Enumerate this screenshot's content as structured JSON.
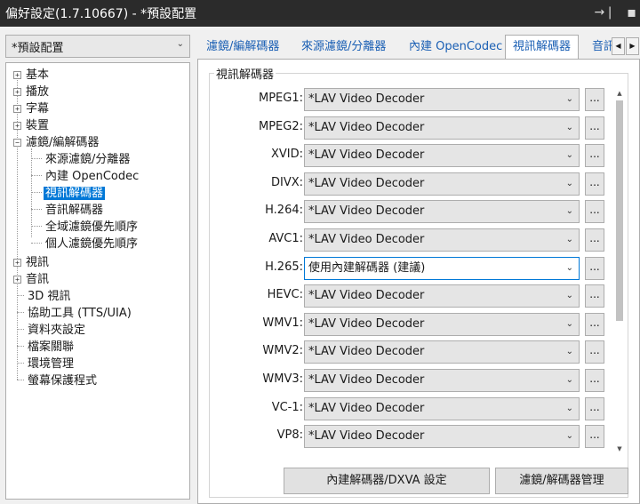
{
  "window": {
    "title": "偏好設定(1.7.10667) - *預設配置"
  },
  "preset": {
    "value": "*預設配置"
  },
  "tree": {
    "items": [
      {
        "label": "基本",
        "expander": "+"
      },
      {
        "label": "播放",
        "expander": "+"
      },
      {
        "label": "字幕",
        "expander": "+"
      },
      {
        "label": "裝置",
        "expander": "+"
      },
      {
        "label": "濾鏡/編解碼器",
        "expander": "−"
      },
      {
        "label": "來源濾鏡/分離器"
      },
      {
        "label": "內建 OpenCodec"
      },
      {
        "label": "視訊解碼器",
        "selected": true
      },
      {
        "label": "音訊解碼器"
      },
      {
        "label": "全域濾鏡優先順序"
      },
      {
        "label": "個人濾鏡優先順序"
      },
      {
        "label": "視訊",
        "expander": "+"
      },
      {
        "label": "音訊",
        "expander": "+"
      },
      {
        "label": "3D 視訊"
      },
      {
        "label": "協助工具 (TTS/UIA)"
      },
      {
        "label": "資料夾設定"
      },
      {
        "label": "檔案關聯"
      },
      {
        "label": "環境管理"
      },
      {
        "label": "螢幕保護程式"
      }
    ]
  },
  "tabs": [
    {
      "label": "濾鏡/編解碼器"
    },
    {
      "label": "來源濾鏡/分離器"
    },
    {
      "label": "內建 OpenCodec"
    },
    {
      "label": "視訊解碼器",
      "active": true
    },
    {
      "label": "音訊"
    }
  ],
  "group": {
    "title": "視訊解碼器"
  },
  "decoders": [
    {
      "label": "MPEG1:",
      "value": "*LAV Video Decoder"
    },
    {
      "label": "MPEG2:",
      "value": "*LAV Video Decoder"
    },
    {
      "label": "XVID:",
      "value": "*LAV Video Decoder"
    },
    {
      "label": "DIVX:",
      "value": "*LAV Video Decoder"
    },
    {
      "label": "H.264:",
      "value": "*LAV Video Decoder"
    },
    {
      "label": "AVC1:",
      "value": "*LAV Video Decoder"
    },
    {
      "label": "H.265:",
      "value": "使用內建解碼器 (建議)"
    },
    {
      "label": "HEVC:",
      "value": "*LAV Video Decoder"
    },
    {
      "label": "WMV1:",
      "value": "*LAV Video Decoder"
    },
    {
      "label": "WMV2:",
      "value": "*LAV Video Decoder"
    },
    {
      "label": "WMV3:",
      "value": "*LAV Video Decoder"
    },
    {
      "label": "VC-1:",
      "value": "*LAV Video Decoder"
    },
    {
      "label": "VP8:",
      "value": "*LAV Video Decoder"
    }
  ],
  "more_label": "...",
  "buttons": {
    "dxva": "內建解碼器/DXVA 設定",
    "manage": "濾鏡/解碼器管理"
  },
  "colors": {
    "titlebar": "#2b2b2b",
    "selection": "#0078d7",
    "tab_text": "#1a5fb4"
  }
}
